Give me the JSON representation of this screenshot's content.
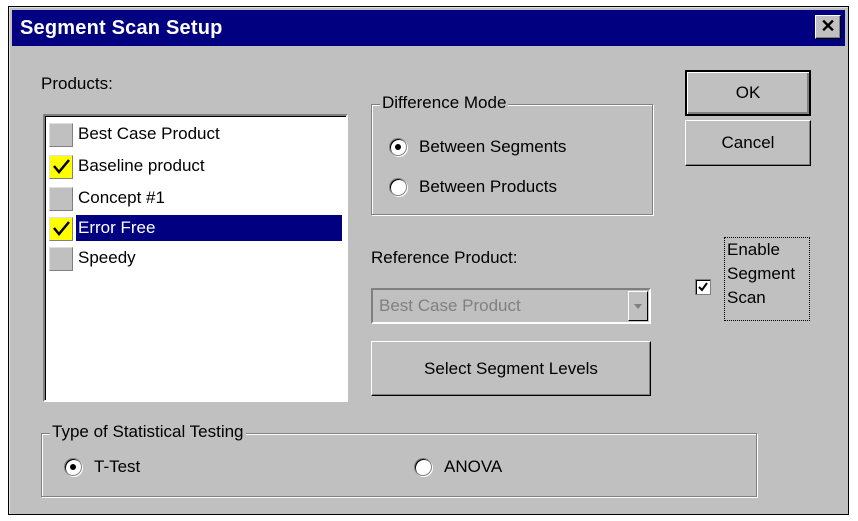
{
  "window": {
    "title": "Segment Scan Setup",
    "close_glyph": "✕"
  },
  "products": {
    "label": "Products:",
    "items": [
      {
        "label": "Best Case Product",
        "checked": false,
        "selected": false
      },
      {
        "label": "Baseline product",
        "checked": true,
        "selected": false
      },
      {
        "label": "Concept #1",
        "checked": false,
        "selected": false
      },
      {
        "label": "Error Free",
        "checked": true,
        "selected": true
      },
      {
        "label": "Speedy",
        "checked": false,
        "selected": false
      }
    ]
  },
  "difference_mode": {
    "title": "Difference Mode",
    "options": [
      {
        "label": "Between Segments",
        "selected": true
      },
      {
        "label": "Between Products",
        "selected": false
      }
    ]
  },
  "reference_product": {
    "label": "Reference Product:",
    "value": "Best Case Product",
    "enabled": false
  },
  "buttons": {
    "ok": "OK",
    "cancel": "Cancel",
    "select_levels": "Select Segment Levels"
  },
  "enable_scan": {
    "label_lines": [
      "Enable",
      "Segment",
      "Scan"
    ],
    "checked": true
  },
  "stat_testing": {
    "title": "Type of Statistical Testing",
    "options": [
      {
        "label": "T-Test",
        "selected": true
      },
      {
        "label": "ANOVA",
        "selected": false
      }
    ]
  },
  "colors": {
    "titlebar": "#000080",
    "face": "#c0c0c0",
    "highlight": "#ffff00",
    "selection": "#000080"
  }
}
